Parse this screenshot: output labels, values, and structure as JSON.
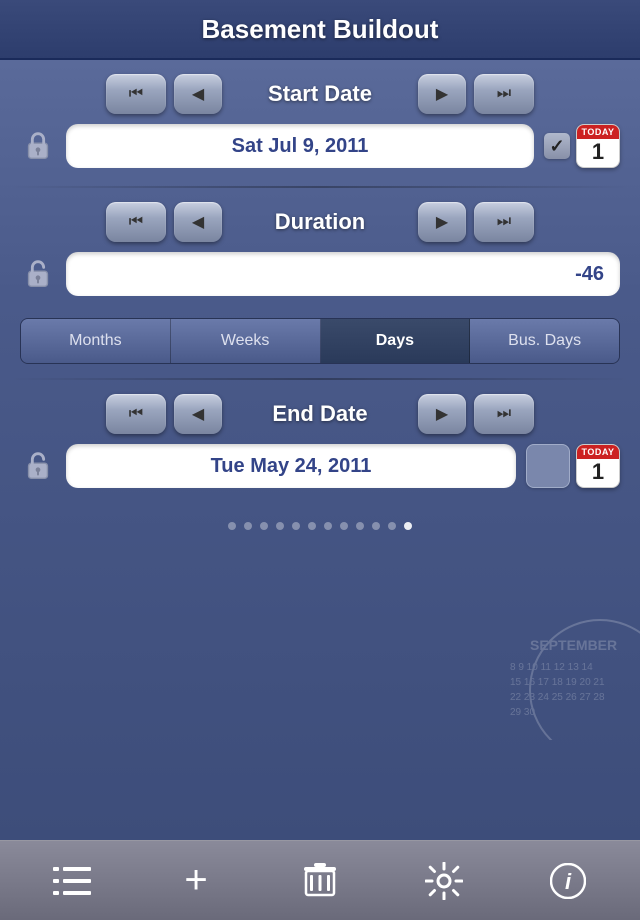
{
  "header": {
    "title": "Basement Buildout"
  },
  "start_date_section": {
    "nav_label": "Start Date",
    "date_value": "Sat Jul 9, 2011",
    "checkbox_checked": true,
    "today_label": "TODAY",
    "today_number": "1"
  },
  "duration_section": {
    "nav_label": "Duration",
    "duration_value": "-46",
    "units": [
      {
        "label": "Months",
        "active": false
      },
      {
        "label": "Weeks",
        "active": false
      },
      {
        "label": "Days",
        "active": true
      },
      {
        "label": "Bus. Days",
        "active": false
      }
    ]
  },
  "end_date_section": {
    "nav_label": "End Date",
    "date_value": "Tue May 24, 2011",
    "today_label": "TODAY",
    "today_number": "1"
  },
  "page_dots": {
    "total": 12,
    "active_index": 11
  },
  "toolbar": {
    "items_icon": "≡",
    "add_icon": "+",
    "delete_icon": "🗑",
    "settings_icon": "⚙",
    "info_icon": "ℹ"
  }
}
